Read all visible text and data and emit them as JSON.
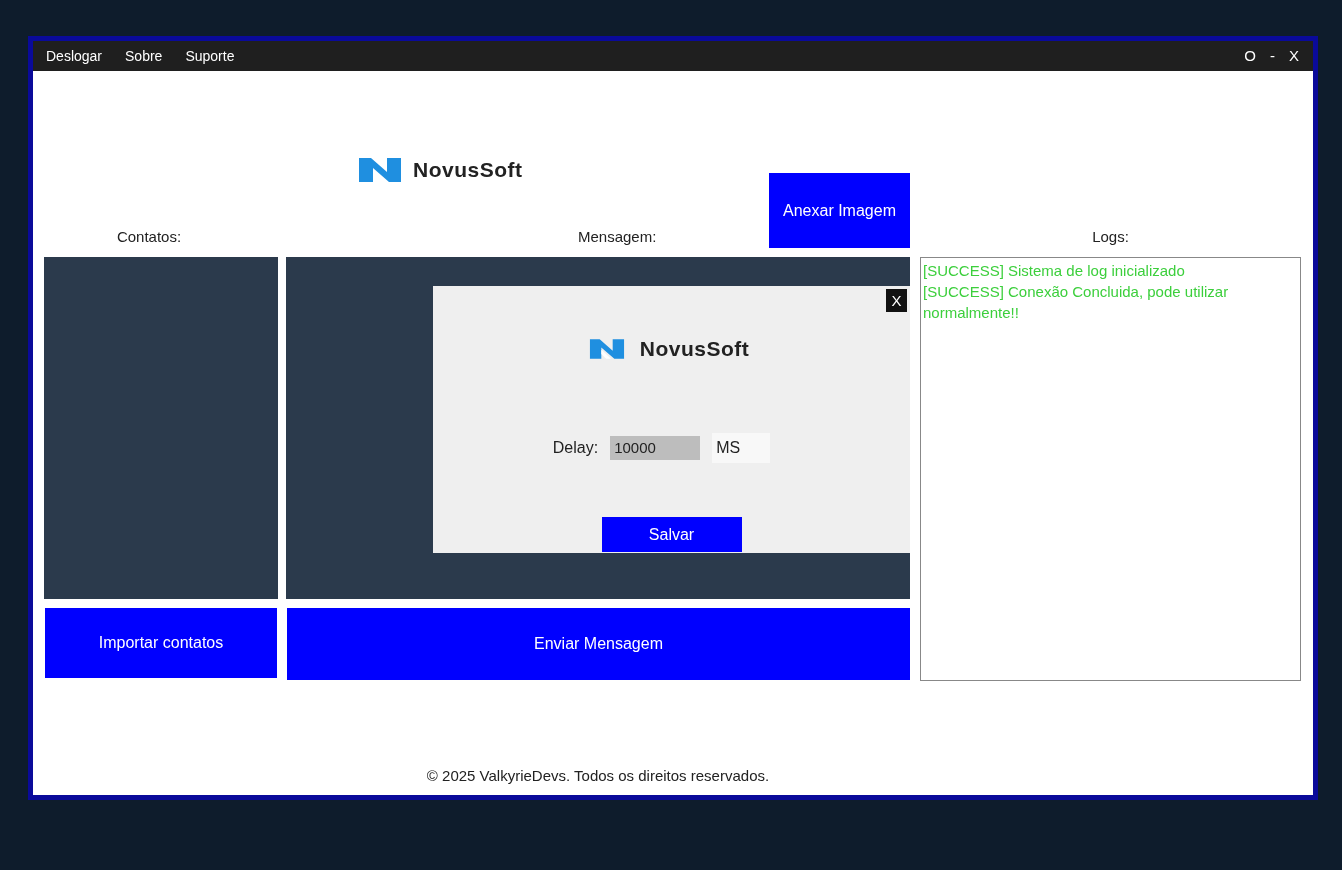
{
  "menu": [
    "Deslogar",
    "Sobre",
    "Suporte"
  ],
  "window_controls": [
    "O",
    "-",
    "X"
  ],
  "brand": "NovusSoft",
  "attach_button": "Anexar Imagem",
  "contacts": {
    "label": "Contatos:",
    "button": "Importar contatos"
  },
  "message": {
    "label": "Mensagem:",
    "button": "Enviar Mensagem"
  },
  "logs": {
    "label": "Logs:",
    "entries": [
      {
        "text": "[SUCCESS] Sistema de log inicializado",
        "color": "#3ccf3c"
      },
      {
        "text": "[SUCCESS] Conexão Concluida, pode utilizar normalmente!!",
        "color": "#3ccf3c"
      }
    ]
  },
  "dialog": {
    "close": "X",
    "brand": "NovusSoft",
    "delay_label": "Delay:",
    "delay_value": "10000",
    "unit": "MS",
    "save_button": "Salvar"
  },
  "footer": "© 2025 ValkyrieDevs. Todos os direitos reservados."
}
